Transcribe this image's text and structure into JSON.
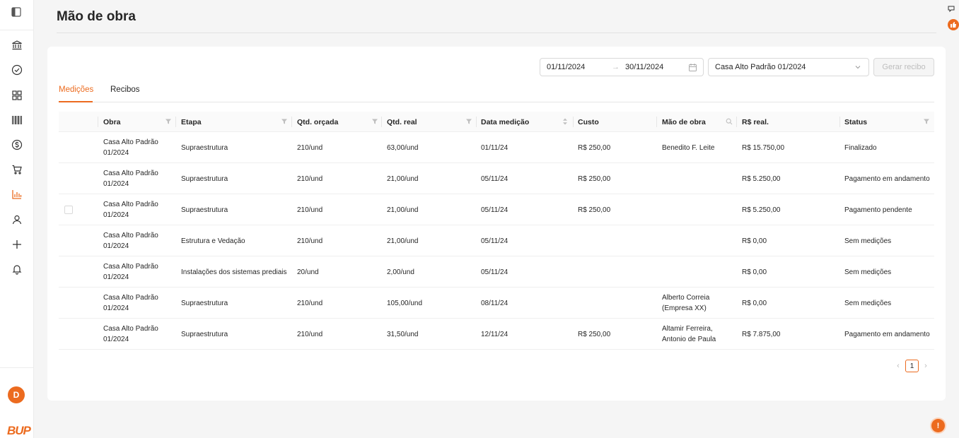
{
  "page": {
    "title": "Mão de obra"
  },
  "brand": {
    "accent": "#ec6b1f",
    "logo_text": "BUP"
  },
  "user": {
    "avatar_initial": "D"
  },
  "sidebar": {
    "items": [
      {
        "icon": "bank-icon"
      },
      {
        "icon": "check-circle-icon"
      },
      {
        "icon": "grid-icon"
      },
      {
        "icon": "barcode-icon"
      },
      {
        "icon": "dollar-circle-icon"
      },
      {
        "icon": "cart-icon"
      },
      {
        "icon": "bar-chart-icon",
        "active": true
      },
      {
        "icon": "user-icon"
      },
      {
        "icon": "plus-icon"
      },
      {
        "icon": "bell-icon"
      }
    ]
  },
  "filters": {
    "date_start": "01/11/2024",
    "date_end": "30/11/2024",
    "obra_selected": "Casa Alto Padrão 01/2024",
    "generate_label": "Gerar recibo"
  },
  "tabs": [
    {
      "label": "Medições",
      "active": true
    },
    {
      "label": "Recibos",
      "active": false
    }
  ],
  "table": {
    "columns": [
      "Obra",
      "Etapa",
      "Qtd. orçada",
      "Qtd. real",
      "Data medição",
      "Custo",
      "Mão de obra",
      "R$ real.",
      "Status"
    ],
    "rows": [
      {
        "obra": "Casa Alto Padrão 01/2024",
        "etapa": "Supraestrutura",
        "qtd_orcada": "210/und",
        "qtd_real": "63,00/und",
        "data": "01/11/24",
        "custo": "R$ 250,00",
        "mao_de_obra": "Benedito F. Leite",
        "real": "R$ 15.750,00",
        "status": "Finalizado"
      },
      {
        "obra": "Casa Alto Padrão 01/2024",
        "etapa": "Supraestrutura",
        "qtd_orcada": "210/und",
        "qtd_real": "21,00/und",
        "data": "05/11/24",
        "custo": "R$ 250,00",
        "mao_de_obra": "",
        "real": "R$ 5.250,00",
        "status": "Pagamento em andamento"
      },
      {
        "obra": "Casa Alto Padrão 01/2024",
        "etapa": "Supraestrutura",
        "qtd_orcada": "210/und",
        "qtd_real": "21,00/und",
        "data": "05/11/24",
        "custo": "R$ 250,00",
        "mao_de_obra": "",
        "real": "R$ 5.250,00",
        "status": "Pagamento pendente"
      },
      {
        "obra": "Casa Alto Padrão 01/2024",
        "etapa": "Estrutura e Vedação",
        "qtd_orcada": "210/und",
        "qtd_real": "21,00/und",
        "data": "05/11/24",
        "custo": "",
        "mao_de_obra": "",
        "real": "R$ 0,00",
        "status": "Sem medições"
      },
      {
        "obra": "Casa Alto Padrão 01/2024",
        "etapa": "Instalações dos sistemas prediais",
        "qtd_orcada": "20/und",
        "qtd_real": "2,00/und",
        "data": "05/11/24",
        "custo": "",
        "mao_de_obra": "",
        "real": "R$ 0,00",
        "status": "Sem medições"
      },
      {
        "obra": "Casa Alto Padrão 01/2024",
        "etapa": "Supraestrutura",
        "qtd_orcada": "210/und",
        "qtd_real": "105,00/und",
        "data": "08/11/24",
        "custo": "",
        "mao_de_obra": "Alberto Correia (Empresa XX)",
        "real": "R$ 0,00",
        "status": "Sem medições"
      },
      {
        "obra": "Casa Alto Padrão 01/2024",
        "etapa": "Supraestrutura",
        "qtd_orcada": "210/und",
        "qtd_real": "31,50/und",
        "data": "12/11/24",
        "custo": "R$ 250,00",
        "mao_de_obra": "Altamir Ferreira, Antonio de Paula",
        "real": "R$ 7.875,00",
        "status": "Pagamento em andamento"
      }
    ]
  },
  "pagination": {
    "current": "1"
  }
}
